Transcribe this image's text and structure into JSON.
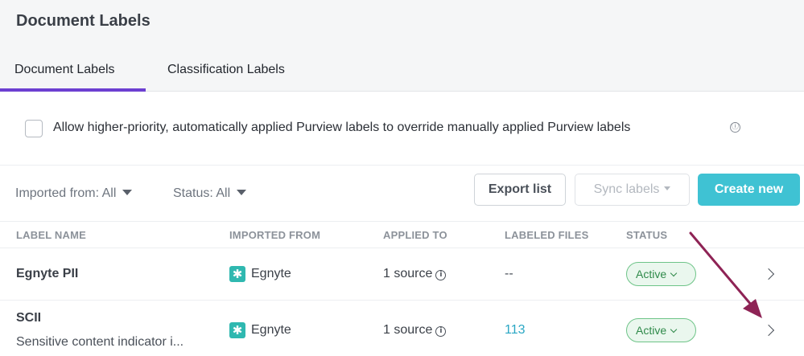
{
  "page": {
    "title": "Document Labels"
  },
  "tabs": [
    {
      "label": "Document Labels",
      "active": true
    },
    {
      "label": "Classification Labels",
      "active": false
    }
  ],
  "override_option": {
    "label": "Allow higher-priority, automatically applied Purview labels to override manually applied Purview labels",
    "checked": false,
    "info_icon": "ⓘ"
  },
  "filters": {
    "imported_from": "Imported from: All",
    "status": "Status: All"
  },
  "toolbar": {
    "export_label": "Export list",
    "sync_label": "Sync labels",
    "create_label": "Create new"
  },
  "table": {
    "columns": [
      "LABEL NAME",
      "IMPORTED FROM",
      "APPLIED TO",
      "LABELED FILES",
      "STATUS"
    ],
    "rows": [
      {
        "name": "Egnyte PII",
        "description": "",
        "imported_from": "Egnyte",
        "applied_to": "1 source",
        "labeled_files": "--",
        "status": "Active"
      },
      {
        "name": "SCII",
        "description": "Sensitive content indicator i...",
        "imported_from": "Egnyte",
        "applied_to": "1 source",
        "labeled_files": "113",
        "status": "Active"
      }
    ]
  },
  "colors": {
    "accent_tab": "#6c3fd1",
    "primary_button": "#3fc2d3",
    "status_active": "#2f8a4a",
    "annotation_arrow": "#8e2355"
  },
  "icons": {
    "egnyte_logo": "egnyte-logo-icon",
    "info": "info-icon",
    "row_chevron": "chevron-right-icon",
    "dropdown": "caret-down-icon"
  }
}
